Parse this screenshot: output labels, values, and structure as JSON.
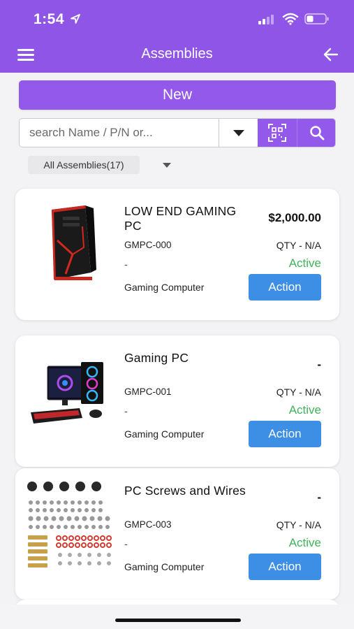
{
  "status_bar": {
    "time": "1:54"
  },
  "header": {
    "title": "Assemblies"
  },
  "new_button": {
    "label": "New"
  },
  "search": {
    "placeholder": "search Name / P/N or..."
  },
  "filter": {
    "label": "All Assemblies(17)"
  },
  "colors": {
    "brand": "#8f55e6",
    "action": "#3d8fe6",
    "active": "#3fb35a"
  },
  "assemblies": [
    {
      "name": "LOW END GAMING PC",
      "price": "$2,000.00",
      "part_number": "GMPC-000",
      "qty": "QTY - N/A",
      "detail": "-",
      "status": "Active",
      "category": "Gaming Computer",
      "action_label": "Action",
      "image": "gaming-tower-image"
    },
    {
      "name": "Gaming PC",
      "price": "-",
      "part_number": "GMPC-001",
      "qty": "QTY - N/A",
      "detail": "-",
      "status": "Active",
      "category": "Gaming Computer",
      "action_label": "Action",
      "image": "gaming-pc-setup-image"
    },
    {
      "name": "PC Screws and Wires",
      "price": "-",
      "part_number": "GMPC-003",
      "qty": "QTY - N/A",
      "detail": "-",
      "status": "Active",
      "category": "Gaming Computer",
      "action_label": "Action",
      "image": "screws-image"
    }
  ]
}
